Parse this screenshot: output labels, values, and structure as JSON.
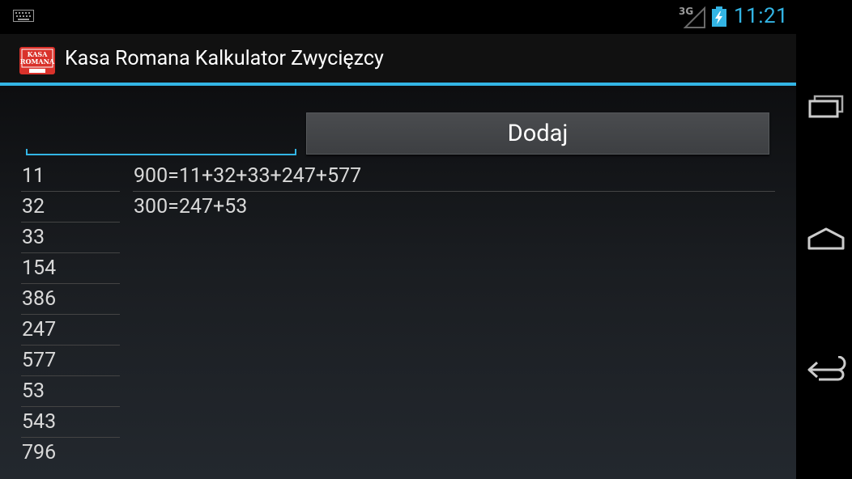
{
  "status_bar": {
    "time": "11:21",
    "network": "3G",
    "icons": [
      "keyboard-icon",
      "signal-icon",
      "battery-charging-icon"
    ],
    "accent": "#33b5e5"
  },
  "action_bar": {
    "title": "Kasa Romana Kalkulator Zwycięzcy",
    "app_icon_text_top": "KASA",
    "app_icon_text_mid": "ROMANA"
  },
  "input": {
    "value": "",
    "placeholder": ""
  },
  "add_button": {
    "label": "Dodaj"
  },
  "numbers": [
    "11",
    "32",
    "33",
    "154",
    "386",
    "247",
    "577",
    "53",
    "543",
    "796"
  ],
  "results": [
    "900=11+32+33+247+577",
    "300=247+53"
  ],
  "nav_bar": {
    "icons": [
      "recent-apps-icon",
      "home-icon",
      "back-icon"
    ]
  }
}
